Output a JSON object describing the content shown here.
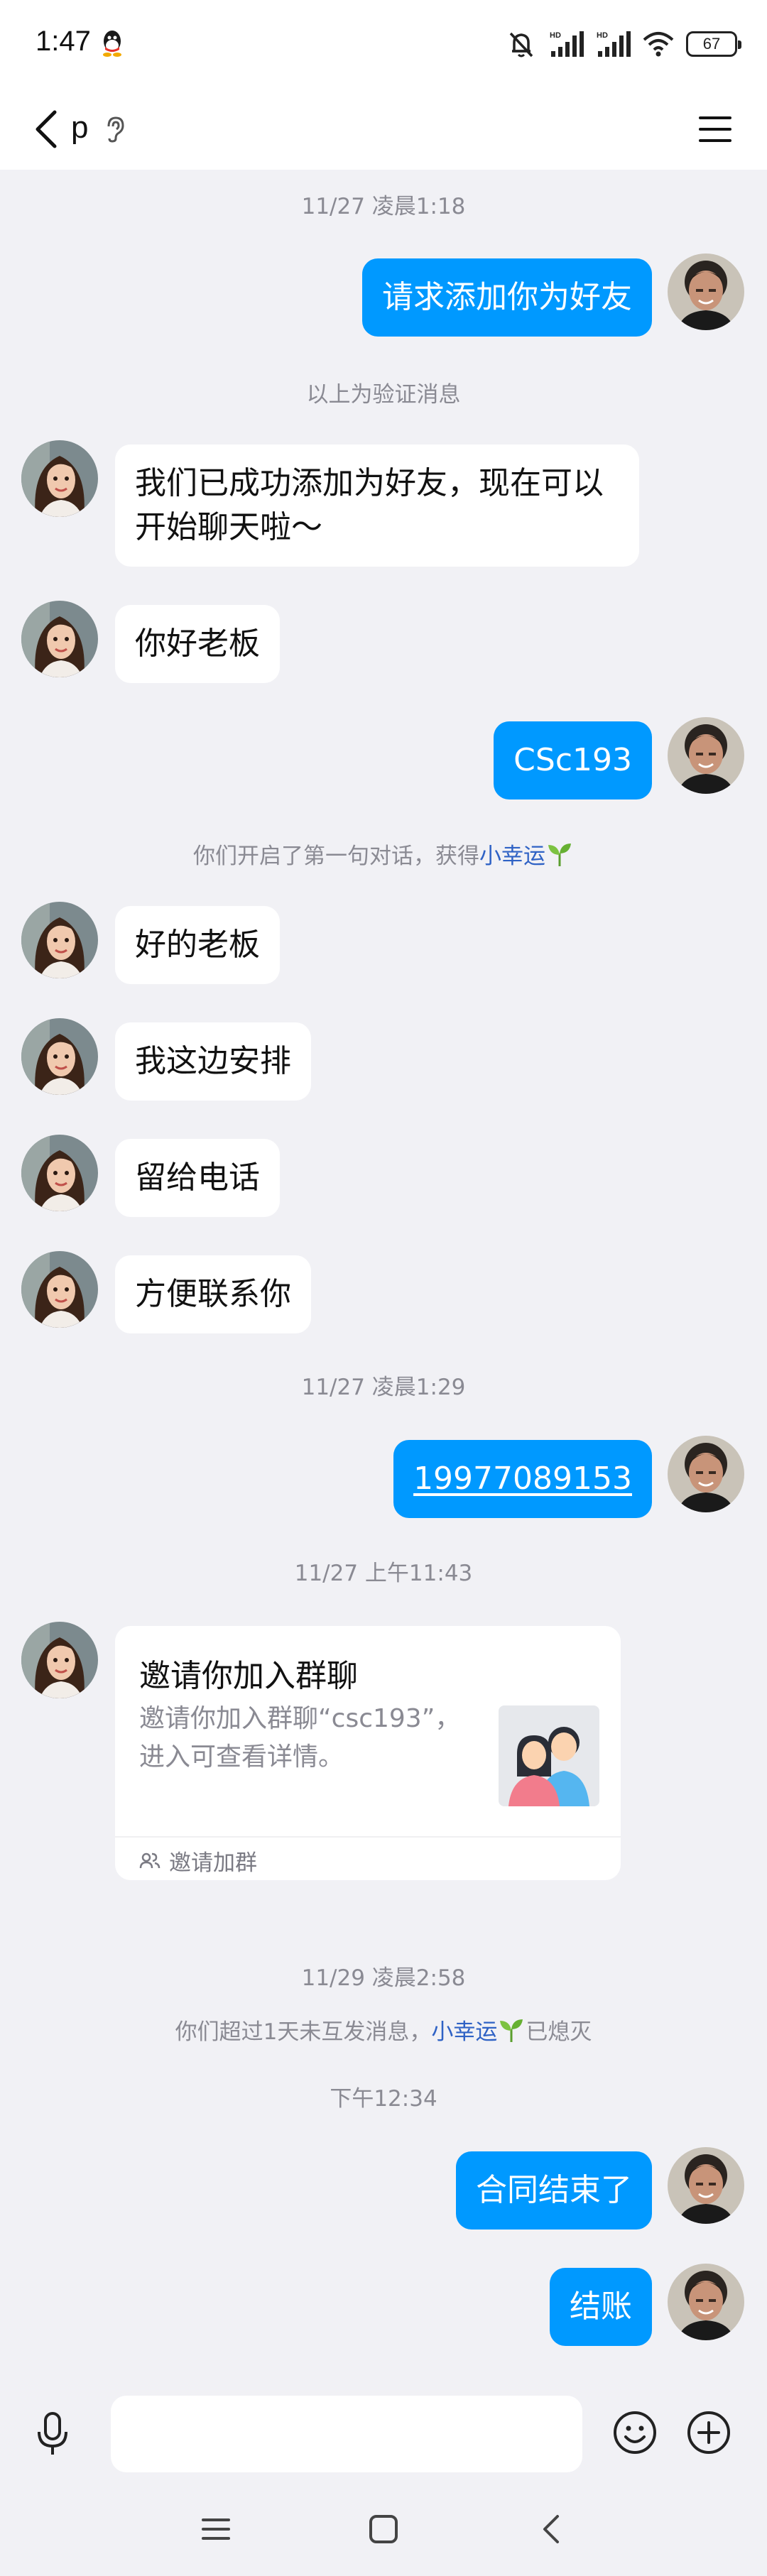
{
  "status_bar": {
    "time": "1:47",
    "battery": "67",
    "signal_label_1": "HD",
    "signal_label_2": "HD",
    "icons": [
      "qq-icon",
      "mute-icon",
      "signal-icon",
      "signal-icon",
      "wifi-icon",
      "battery-icon"
    ]
  },
  "header": {
    "title": "p",
    "icons": [
      "back-icon",
      "ear-icon",
      "menu-icon"
    ]
  },
  "messages": {
    "ts1": "11/27 凌晨1:18",
    "m1": "请求添加你为好友",
    "sys1": "以上为验证消息",
    "m2": "我们已成功添加为好友，现在可以开始聊天啦～",
    "m3": "你好老板",
    "m4": "CSc193",
    "sys2_prefix": "你们开启了第一句对话，获得",
    "sys2_link": "小幸运",
    "m5": "好的老板",
    "m6": "我这边安排",
    "m7": "留给电话",
    "m8": "方便联系你",
    "ts2": "11/27 凌晨1:29",
    "m9": "19977089153",
    "ts3": "11/27 上午11:43",
    "ts4": "11/29 凌晨2:58",
    "sys3_prefix": "你们超过1天未互发消息，",
    "sys3_link": "小幸运",
    "sys3_suffix": "已熄灭",
    "ts5": "下午12:34",
    "m10": "合同结束了",
    "m11": "结账"
  },
  "invite_card": {
    "title": "邀请你加入群聊",
    "description": "邀请你加入群聊“csc193”，进入可查看详情。",
    "footer": "邀请加群"
  },
  "input_bar": {
    "placeholder": "",
    "icons": [
      "mic-icon",
      "emoji-icon",
      "plus-icon"
    ]
  },
  "nav_bar": {
    "icons": [
      "recents-icon",
      "home-icon",
      "back-nav-icon"
    ]
  },
  "colors": {
    "accent": "#0099FF",
    "background": "#F1F1F5",
    "link": "#2F62C5"
  }
}
